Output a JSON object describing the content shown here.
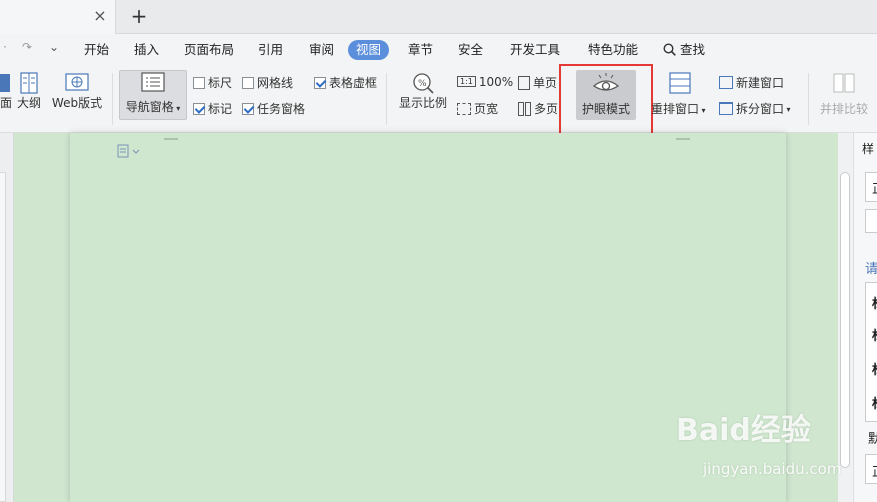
{
  "tabbar": {
    "close_glyph": "×",
    "add_glyph": "+"
  },
  "menubar": {
    "items": [
      "开始",
      "插入",
      "页面布局",
      "引用",
      "审阅",
      "视图",
      "章节",
      "安全",
      "开发工具",
      "特色功能",
      "查找"
    ],
    "active": "视图"
  },
  "ribbon": {
    "page_view_partial": "面",
    "outline": "大纲",
    "web_layout": "Web版式",
    "nav_pane": "导航窗格",
    "ruler": "标尺",
    "gridlines": "网格线",
    "table_gridlines": "表格虚框",
    "markup": "标记",
    "task_pane": "任务窗格",
    "zoom": "显示比例",
    "zoom_100": "100%",
    "one_to_one": "1:1",
    "page_width": "页宽",
    "single_page": "单页",
    "multi_page": "多页",
    "eye_mode": "护眼模式",
    "rearrange_window": "重排窗口",
    "new_window": "新建窗口",
    "split_window": "拆分窗口",
    "side_by_side": "并排比较",
    "checkbox_state": {
      "ruler": false,
      "gridlines": false,
      "table_gridlines": true,
      "markup": true,
      "task_pane": true
    }
  },
  "right_panel": {
    "header_partial": "样",
    "prompt_partial": "请",
    "lines": [
      "正",
      "标",
      "标",
      "标",
      "标",
      "默",
      "正"
    ]
  },
  "watermark": {
    "main": "Baid经验",
    "sub": "jingyan.baidu.com"
  },
  "colors": {
    "accent": "#5b8fdc",
    "eye_green": "#d0e6cf",
    "highlight": "#e53935"
  }
}
